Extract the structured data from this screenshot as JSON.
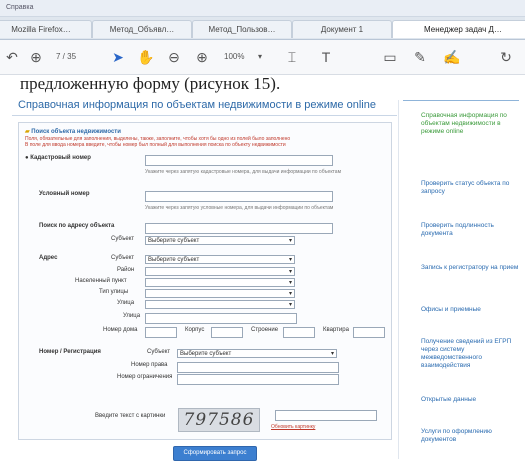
{
  "browser": {
    "top_label": "Справка",
    "tabs": [
      {
        "label": "Mozilla Firefox…"
      },
      {
        "label": "Метод_Объявл…"
      },
      {
        "label": "Метод_Пользов…"
      },
      {
        "label": "Документ 1"
      },
      {
        "label": "Менеджер задач Д…"
      }
    ]
  },
  "toolbar": {
    "page_counter": "7 / 35",
    "zoom": "100%",
    "icons": [
      "undo-icon",
      "save-icon",
      "pointer-icon",
      "hand-icon",
      "zoom-out-icon",
      "zoom-in-icon",
      "select-icon",
      "text-icon",
      "comment-icon",
      "pen-icon",
      "sign-icon",
      "share-icon"
    ]
  },
  "doc": {
    "heading": "предложенную форму (рисунок 15).",
    "form_title": "Справочная информация по объектам недвижимости в режиме online"
  },
  "form": {
    "section_label": "Поиск объекта недвижимости",
    "warning1": "Поля, обязательные для заполнения, выделены, также, заполните, чтобы хотя бы одно из полей было заполнено",
    "warning2": "В поле для ввода номера введите, чтобы номер был полный для выполнения поиска по объекту недвижимости",
    "cadastral_label": "Кадастровый номер",
    "cadastral_hint": "Укажите через запятую кадастровые номера, для выдачи информации по объектам",
    "conditional_label": "Условный номер",
    "conditional_hint": "Укажите через запятую условные номера, для выдачи информации по объектам",
    "address_block_label": "Поиск по адресу объекта",
    "subject_label": "Субъект",
    "subject_value": "Выберите субъект",
    "address_label": "Адрес",
    "addr_subject_label": "Субъект",
    "addr_subject_value": "Выберите субъект",
    "area_label": "Район",
    "settlement_label": "Населенный пункт",
    "street_type_label": "Тип улицы",
    "street_label": "Улица",
    "house_label": "Номер дома",
    "building_label": "Корпус",
    "structure_label": "Строение",
    "apartment_label": "Квартира",
    "registration_label": "Номер / Регистрация",
    "reg_subject_label": "Субъект",
    "reg_subject_value": "Выберите субъект",
    "reg_number_label": "Номер права",
    "reg_date_label": "Номер ограничения",
    "captcha_label": "Введите текст с картинки",
    "captcha_text": "797586",
    "captcha_refresh": "Обновить картинку",
    "submit_label": "Сформировать запрос"
  },
  "sidebar": {
    "items": [
      {
        "label": "Справочная информация по объектам недвижимости в режиме online",
        "color": "green"
      },
      {
        "label": "Проверить статус объекта по запросу",
        "color": "blue"
      },
      {
        "label": "Проверить подлинность документа",
        "color": "blue"
      },
      {
        "label": "Запись к регистратору на прием",
        "color": "blue"
      },
      {
        "label": "Офисы и приемные",
        "color": "blue"
      },
      {
        "label": "Получение сведений из ЕГРП через систему межведомственного взаимодействия",
        "color": "blue"
      },
      {
        "label": "Открытые данные",
        "color": "blue"
      },
      {
        "label": "Услуги по оформлению документов",
        "color": "blue"
      }
    ]
  },
  "colors": {
    "accent": "#2e6aa8",
    "green": "#3a9a3a",
    "button": "#3c7fd0"
  }
}
